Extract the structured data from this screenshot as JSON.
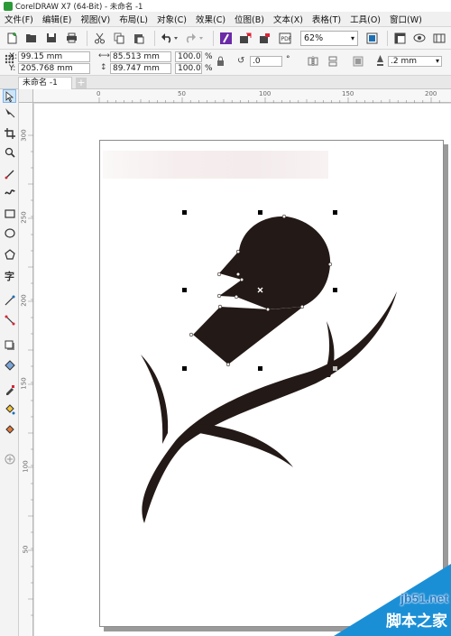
{
  "window": {
    "title": "CorelDRAW X7 (64-Bit) - 未命名 -1"
  },
  "menu": [
    "文件(F)",
    "编辑(E)",
    "视图(V)",
    "布局(L)",
    "对象(C)",
    "效果(C)",
    "位图(B)",
    "文本(X)",
    "表格(T)",
    "工具(O)",
    "窗口(W)"
  ],
  "toolbar": {
    "zoom_value": "62%",
    "icons": [
      "new-icon",
      "open-icon",
      "save-icon",
      "print-icon",
      "cut-icon",
      "copy-icon",
      "paste-icon",
      "undo-icon",
      "redo-icon",
      "corel-connect-icon",
      "import-icon",
      "export-icon",
      "publish-pdf-icon",
      "full-screen-icon",
      "show-rulers-icon",
      "view-icon",
      "snap-icon"
    ]
  },
  "property_bar": {
    "x_label": "X:",
    "x_value": "99.15 mm",
    "y_label": "Y:",
    "y_value": "205.768 mm",
    "width_value": "85.513 mm",
    "height_value": "89.747 mm",
    "scale_x": "100.0",
    "scale_y": "100.0",
    "percent": "%",
    "rotation_value": ".0",
    "degree": "°",
    "outline_width": ".2 mm"
  },
  "document_tab": {
    "label": "未命名 -1",
    "add_label": "+"
  },
  "ruler": {
    "h_labels": [
      "0",
      "50",
      "100",
      "150",
      "200"
    ],
    "v_labels": [
      "300",
      "250",
      "200",
      "150",
      "100",
      "50"
    ]
  },
  "tools": [
    "pick-tool-icon",
    "shape-tool-icon",
    "crop-tool-icon",
    "zoom-tool-icon",
    "freehand-tool-icon",
    "artistic-media-icon",
    "rectangle-tool-icon",
    "ellipse-tool-icon",
    "polygon-tool-icon",
    "text-tool-icon",
    "parallel-dimension-icon",
    "connector-tool-icon",
    "drop-shadow-icon",
    "transparency-tool-icon",
    "color-eyedropper-icon",
    "interactive-fill-icon",
    "smart-fill-icon",
    "add-tool-icon"
  ],
  "colors": {
    "artwork": "#231916",
    "accent": "#1b8fd6"
  },
  "watermark": {
    "url": "jb51.net",
    "name": "脚本之家"
  }
}
